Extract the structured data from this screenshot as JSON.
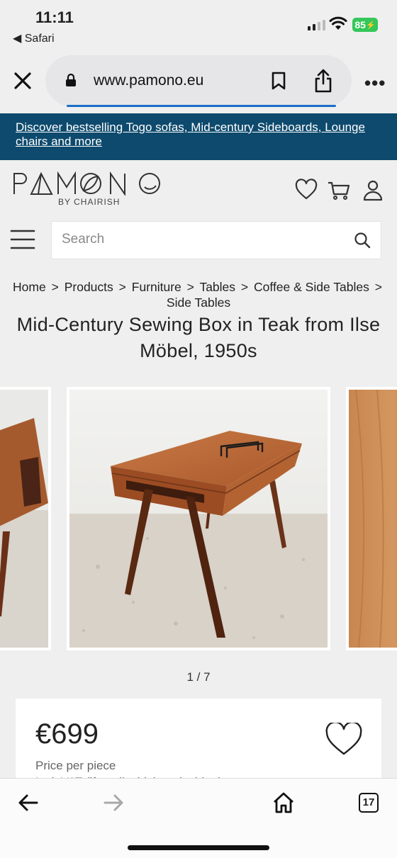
{
  "status": {
    "time": "11:11",
    "back_app": "◀ Safari",
    "battery": "85"
  },
  "browser": {
    "url": "www.pamono.eu"
  },
  "promo": {
    "text": "Discover bestselling Togo sofas, Mid-century Sideboards, Lounge chairs and more"
  },
  "brand": {
    "logo": "PAMONO",
    "subtitle": "BY CHAIRISH"
  },
  "search": {
    "placeholder": "Search"
  },
  "breadcrumb": {
    "items": [
      "Home",
      "Products",
      "Furniture",
      "Tables",
      "Coffee & Side Tables",
      "Side Tables"
    ],
    "separator": ">"
  },
  "product": {
    "title": "Mid-Century Sewing Box in Teak from Ilse Möbel, 1950s",
    "image_counter": "1 / 7",
    "price": "€699",
    "price_label": "Price per piece",
    "vat_note": "Incl. VAT (if applicable) excl. shipping"
  },
  "toolbar": {
    "tab_count": "17"
  },
  "colors": {
    "banner": "#0d4a6d",
    "battery": "#34c759",
    "teak": "#a0532b"
  },
  "icons": [
    "close-icon",
    "lock-icon",
    "bookmark-icon",
    "share-icon",
    "more-icon",
    "heart-icon",
    "cart-icon",
    "user-icon",
    "menu-icon",
    "search-icon",
    "back-arrow-icon",
    "forward-arrow-icon",
    "home-icon",
    "tabs-icon"
  ]
}
